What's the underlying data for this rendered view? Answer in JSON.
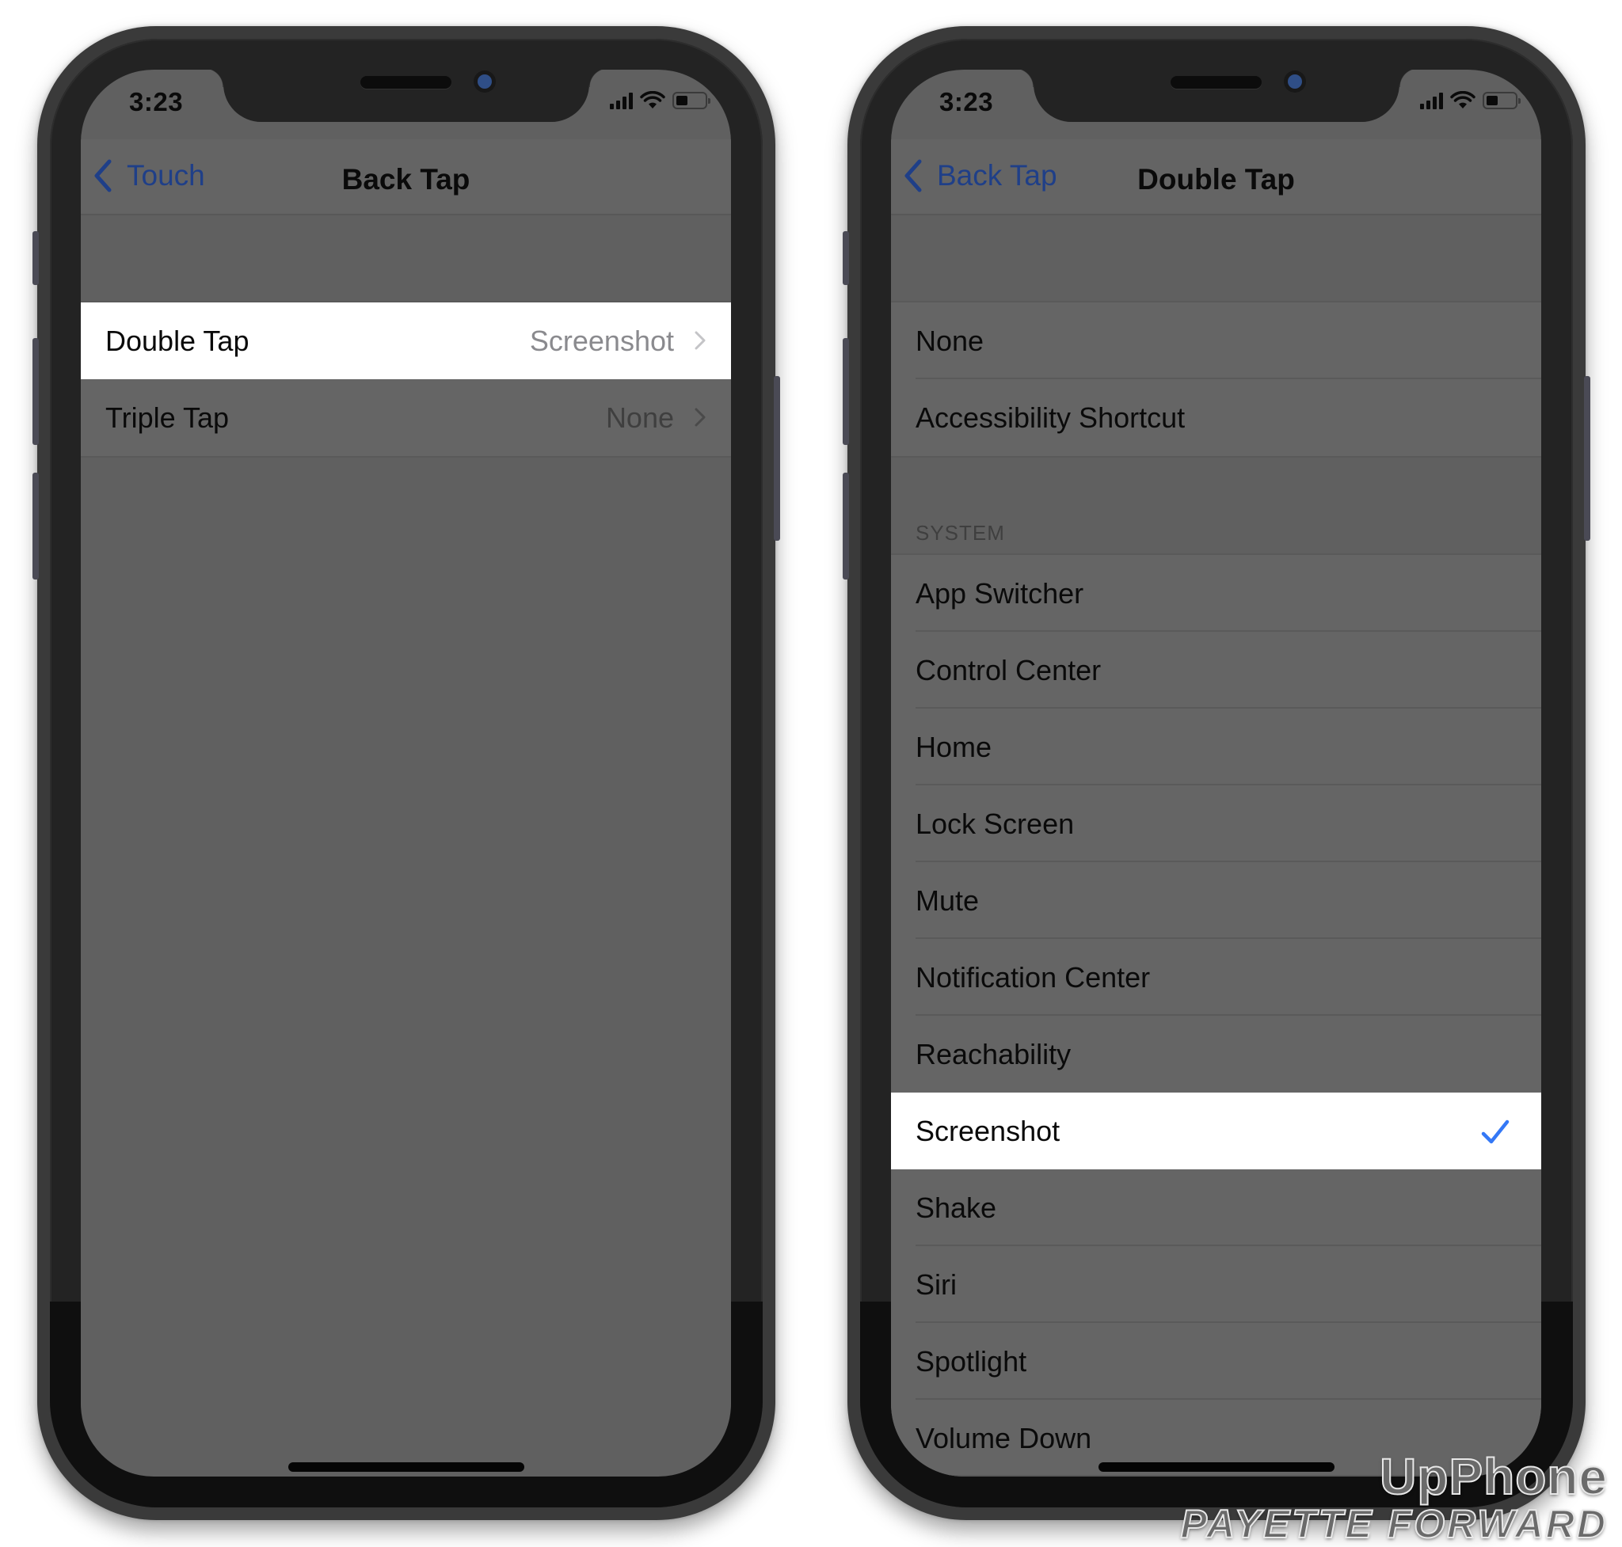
{
  "left_phone": {
    "status": {
      "time": "3:23",
      "battery_level": 0.4
    },
    "nav": {
      "back_label": "Touch",
      "title": "Back Tap"
    },
    "rows": [
      {
        "label": "Double Tap",
        "value": "Screenshot",
        "selected": true
      },
      {
        "label": "Triple Tap",
        "value": "None",
        "selected": false
      }
    ]
  },
  "right_phone": {
    "status": {
      "time": "3:23",
      "battery_level": 0.4
    },
    "nav": {
      "back_label": "Back Tap",
      "title": "Double Tap"
    },
    "top_options": [
      "None",
      "Accessibility Shortcut"
    ],
    "section_header": "SYSTEM",
    "system_options": [
      "App Switcher",
      "Control Center",
      "Home",
      "Lock Screen",
      "Mute",
      "Notification Center",
      "Reachability",
      "Screenshot",
      "Shake",
      "Siri",
      "Spotlight",
      "Volume Down"
    ],
    "selected_option": "Screenshot"
  },
  "watermark": {
    "line1": "UpPhone",
    "line2": "PAYETTE FORWARD"
  },
  "colors": {
    "accent_blue": "#3478f6",
    "back_link": "#1f3f88",
    "highlight": "#ffffff"
  }
}
